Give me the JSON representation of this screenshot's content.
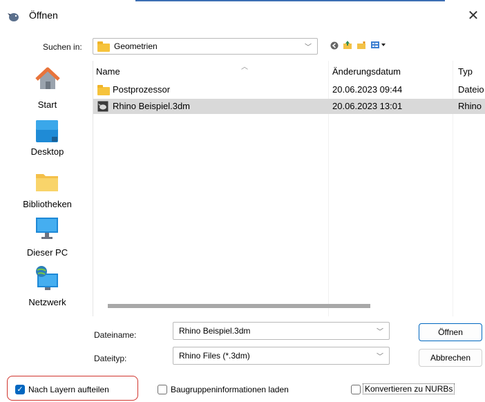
{
  "window": {
    "title": "Öffnen"
  },
  "header": {
    "look_in_label": "Suchen in:",
    "look_in_value": "Geometrien"
  },
  "places": [
    {
      "label": "Start",
      "icon": "home-icon"
    },
    {
      "label": "Desktop",
      "icon": "desktop-icon"
    },
    {
      "label": "Bibliotheken",
      "icon": "library-folder-icon"
    },
    {
      "label": "Dieser PC",
      "icon": "computer-icon"
    },
    {
      "label": "Netzwerk",
      "icon": "network-icon"
    }
  ],
  "columns": {
    "name": "Name",
    "date": "Änderungsdatum",
    "type": "Typ"
  },
  "files": [
    {
      "name": "Postprozessor",
      "date": "20.06.2023 09:44",
      "type": "Dateio",
      "icon": "folder-icon",
      "selected": false
    },
    {
      "name": "Rhino Beispiel.3dm",
      "date": "20.06.2023 13:01",
      "type": "Rhino",
      "icon": "rhino-file-icon",
      "selected": true
    }
  ],
  "footer": {
    "filename_label": "Dateiname:",
    "filename_value": "Rhino Beispiel.3dm",
    "filetype_label": "Dateityp:",
    "filetype_value": "Rhino Files (*.3dm)",
    "open_label": "Öffnen",
    "cancel_label": "Abbrechen"
  },
  "options": [
    {
      "label": "Nach Layern aufteilen",
      "checked": true
    },
    {
      "label": "Baugruppeninformationen laden",
      "checked": false
    },
    {
      "label": "Konvertieren zu NURBs",
      "checked": false
    }
  ],
  "colors": {
    "accent": "#0067c0",
    "highlight": "#d0342c",
    "selection": "#d9d9d9"
  }
}
